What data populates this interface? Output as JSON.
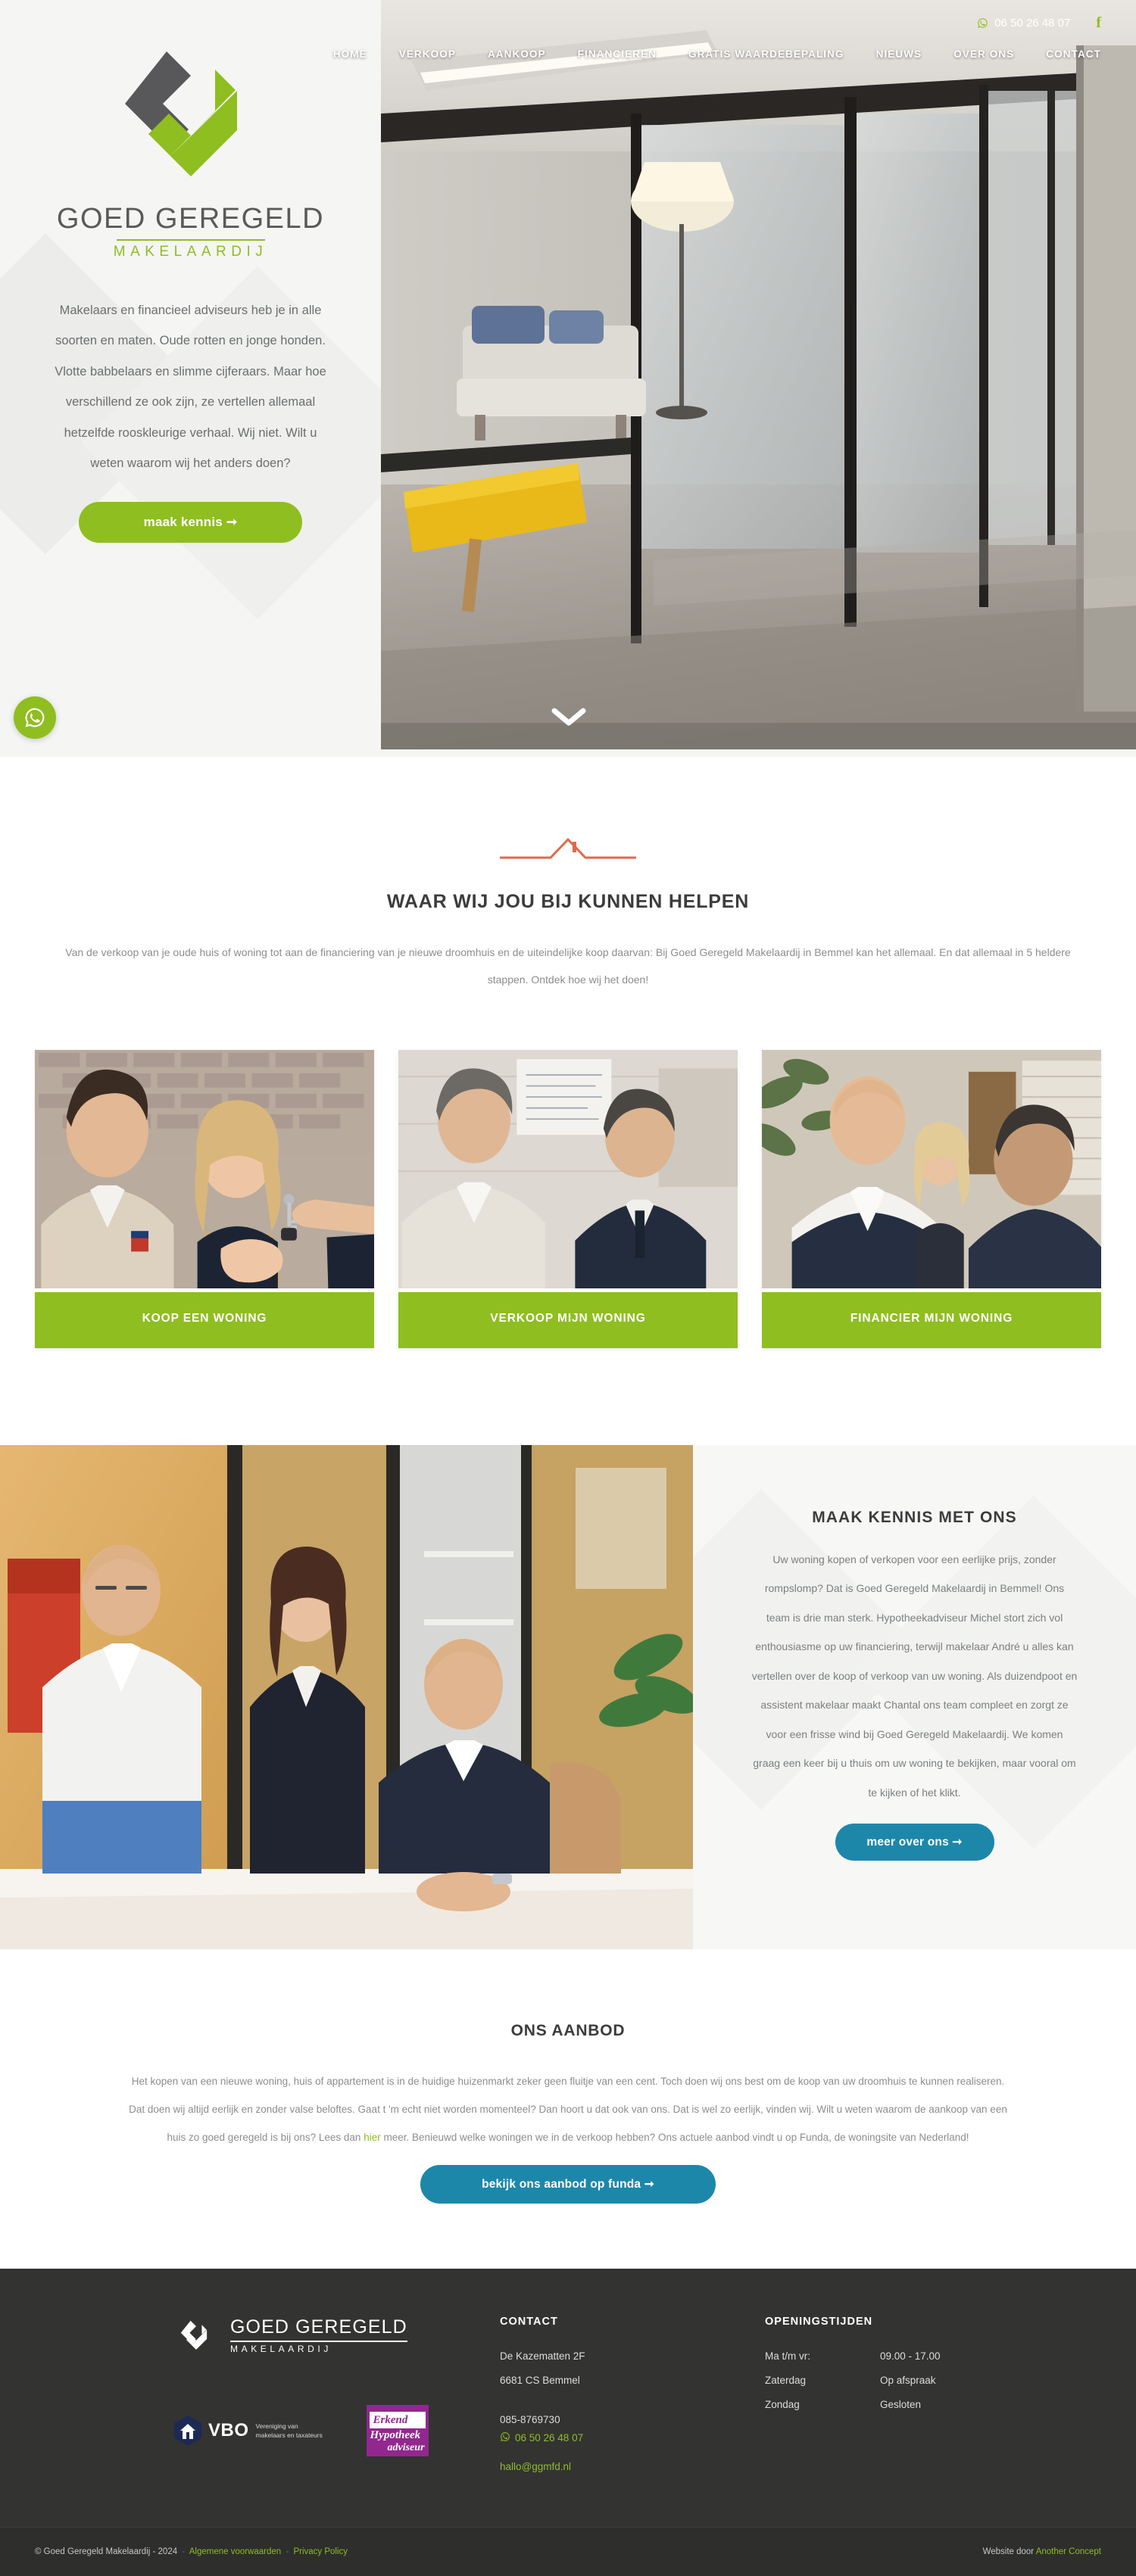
{
  "brand": {
    "name": "GOED GEREGELD",
    "tagline": "MAKELAARDIJ",
    "green": "#8fbe20",
    "blue": "#1d87aa",
    "dark": "#333332"
  },
  "topbar": {
    "phone": "06 50 26 48 07",
    "whatsapp_icon": "whatsapp-icon",
    "facebook_icon": "facebook-icon",
    "facebook_label": "f",
    "nav": [
      {
        "label": "HOME"
      },
      {
        "label": "VERKOOP"
      },
      {
        "label": "AANKOOP"
      },
      {
        "label": "FINANCIEREN"
      },
      {
        "label": "GRATIS WAARDEBEPALING"
      },
      {
        "label": "NIEUWS"
      },
      {
        "label": "OVER ONS"
      },
      {
        "label": "CONTACT"
      }
    ]
  },
  "hero": {
    "intro": "Makelaars en financieel adviseurs heb je in alle soorten en maten. Oude rotten en jonge honden. Vlotte babbelaars en slimme cijferaars. Maar hoe verschillend ze ook zijn, ze vertellen allemaal hetzelfde rooskleurige verhaal. Wij niet. Wilt u weten waarom wij het anders doen?",
    "cta": "maak kennis  ➞",
    "scroll_icon": "chevron-down-icon",
    "whatsapp_float_icon": "whatsapp-icon"
  },
  "help": {
    "ornament": "roof-divider-ornament",
    "title": "WAAR WIJ JOU BIJ KUNNEN HELPEN",
    "body": "Van de verkoop van je oude huis of woning tot aan de financiering van je nieuwe droomhuis en de uiteindelijke koop daarvan: Bij Goed Geregeld Makelaardij in Bemmel kan het allemaal. En dat allemaal in 5 heldere stappen. Ontdek hoe wij het doen!"
  },
  "cards": [
    {
      "label": "KOOP EEN WONING",
      "photo": "couple-receiving-keys"
    },
    {
      "label": "VERKOOP MIJN WONING",
      "photo": "two-men-discussing"
    },
    {
      "label": "FINANCIER MIJN WONING",
      "photo": "advisor-meeting-client"
    }
  ],
  "meet": {
    "photo": "team-of-three-in-office",
    "title": "MAAK KENNIS MET ONS",
    "body": "Uw woning kopen of verkopen voor een eerlijke prijs, zonder rompslomp? Dat is Goed Geregeld Makelaardij in Bemmel! Ons team is drie man sterk. Hypotheekadviseur Michel stort zich vol enthousiasme op uw financiering, terwijl makelaar André u alles kan vertellen over de koop of verkoop van uw woning. Als duizendpoot en assistent makelaar maakt Chantal ons team compleet en zorgt ze voor een frisse wind bij Goed Geregeld Makelaardij. We komen graag een keer bij u thuis om uw woning te bekijken, maar vooral om te kijken of het klikt.",
    "cta": "meer over ons  ➞"
  },
  "offer": {
    "title": "ONS AANBOD",
    "body_1": "Het kopen van een nieuwe woning, huis of appartement is in de huidige huizenmarkt zeker geen fluitje van een cent. Toch doen wij ons best om de koop van uw droomhuis te kunnen realiseren.",
    "body_2": "Dat doen wij altijd eerlijk en zonder valse beloftes. Gaat t 'm echt niet worden momenteel? Dan hoort u dat ook van ons. Dat is wel zo eerlijk, vinden wij. Wilt u weten waarom de aankoop van een",
    "body_3a": "huis zo goed geregeld is bij ons? Lees dan ",
    "body_link": "hier",
    "body_3b": " meer. Benieuwd welke woningen we in de verkoop hebben? Ons actuele aanbod vindt u op Funda, de woningsite van Nederland!",
    "cta": "bekijk ons aanbod op funda  ➞"
  },
  "footer": {
    "vbo": {
      "name": "VBO",
      "tagline": "Vereniging van makelaars en taxateurs",
      "icon": "vbo-house-hex-icon"
    },
    "erkend": {
      "line1": "Erkend",
      "line2": "Hypotheek",
      "line3": "adviseur",
      "icon": "erkend-hypotheekadviseur-badge"
    },
    "contact": {
      "head": "CONTACT",
      "street": "De Kazematten 2F",
      "city": "6681 CS Bemmel",
      "phone": "085-8769730",
      "whatsapp": "06 50 26 48 07",
      "whatsapp_icon": "whatsapp-icon",
      "email": "hallo@ggmfd.nl"
    },
    "hours": {
      "head": "OPENINGSTIJDEN",
      "rows": [
        {
          "day": "Ma t/m vr:",
          "time": "09.00 - 17.00"
        },
        {
          "day": "Zaterdag",
          "time": "Op afspraak"
        },
        {
          "day": "Zondag",
          "time": "Gesloten"
        }
      ]
    },
    "bottom": {
      "copyright": "© Goed Geregeld Makelaardij - 2024",
      "terms": "Algemene voorwaarden",
      "privacy": "Privacy Policy",
      "credit_prefix": "Website door ",
      "credit_link": "Another Concept"
    }
  }
}
